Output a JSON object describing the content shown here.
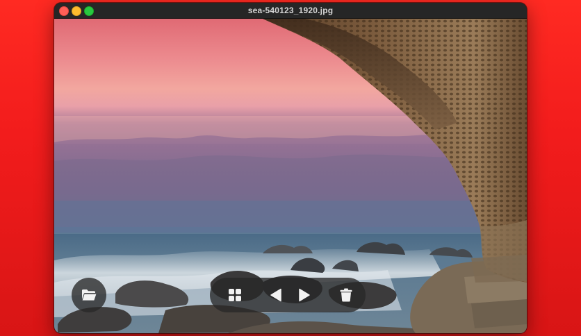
{
  "window": {
    "title": "sea-540123_1920.jpg"
  },
  "icons": {
    "open": "folder-open-icon",
    "grid": "grid-icon",
    "previous": "triangle-left-icon",
    "next": "triangle-right-icon",
    "delete": "trash-icon"
  },
  "colors": {
    "desktop_background": "#f21c1c",
    "titlebar": "#262626",
    "control_background": "#282828"
  }
}
